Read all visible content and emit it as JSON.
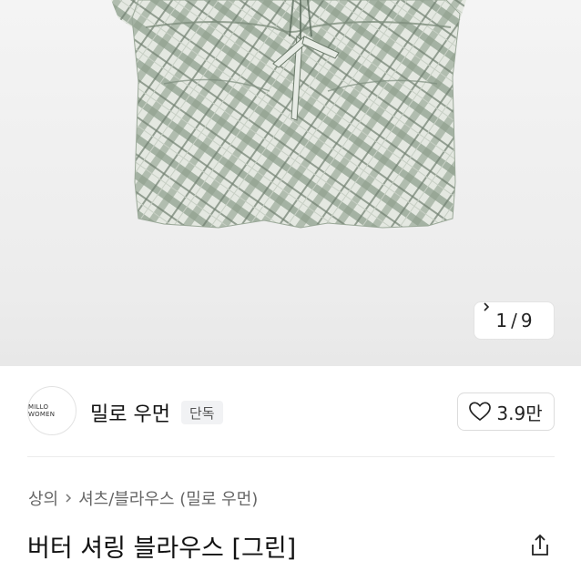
{
  "gallery": {
    "image": "plaid-blouse-photo",
    "counter_current": "1",
    "counter_sep": "/",
    "counter_total": "9",
    "next_icon": "chevron-right-icon",
    "colors": {
      "plaid_base": "#dfe3dc",
      "plaid_line": "#7a8d7a",
      "plaid_dark": "#4f5f52"
    }
  },
  "seller": {
    "logo_text": "MILLO WOMEN",
    "name": "밀로 우먼",
    "badge": "단독",
    "like_icon": "heart-icon",
    "like_count": "3.9만"
  },
  "breadcrumb": {
    "category": "상의",
    "separator_icon": "chevron-right-icon",
    "subcategory": "셔츠/블라우스 (밀로 우먼)"
  },
  "product": {
    "title": "버터 셔링 블라우스 [그린]",
    "share_icon": "share-icon"
  }
}
